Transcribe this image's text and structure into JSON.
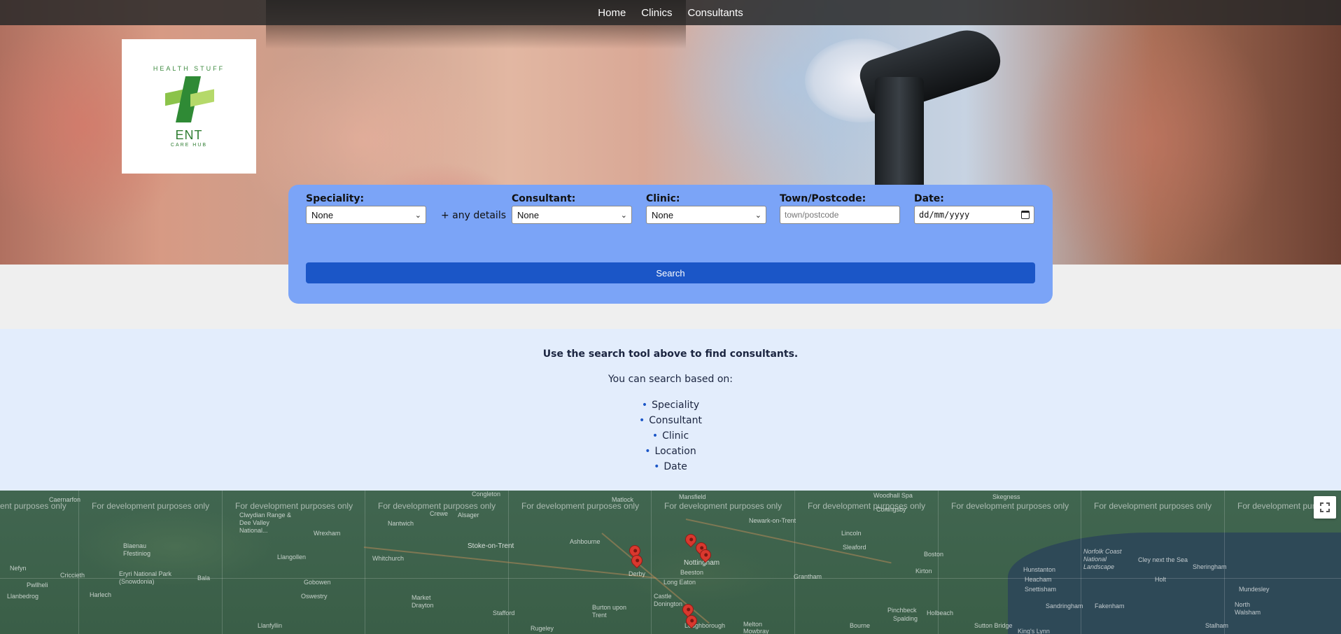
{
  "nav": {
    "items": [
      {
        "label": "Home"
      },
      {
        "label": "Clinics"
      },
      {
        "label": "Consultants"
      }
    ]
  },
  "logo": {
    "arc_text": "HEALTH STUFF",
    "name": "ENT",
    "tagline": "CARE HUB",
    "colors": {
      "primary": "#2f8a35",
      "secondary": "#8bc34a"
    }
  },
  "search": {
    "speciality": {
      "label": "Speciality:",
      "value": "None"
    },
    "any_details": "+ any details",
    "consultant": {
      "label": "Consultant:",
      "value": "None"
    },
    "clinic": {
      "label": "Clinic:",
      "value": "None"
    },
    "town": {
      "label": "Town/Postcode:",
      "placeholder": "town/postcode"
    },
    "date": {
      "label": "Date:",
      "value": "dd/mm/yyyy"
    },
    "button_label": "Search",
    "panel_color": "#7ba4f7",
    "button_color": "#1b56c7"
  },
  "info": {
    "title": "Use the search tool above to find consultants.",
    "subtitle": "You can search based on:",
    "items": [
      "Speciality",
      "Consultant",
      "Clinic",
      "Location",
      "Date"
    ]
  },
  "map": {
    "watermark": "For development purposes only",
    "watermark_start": "ent purposes only",
    "watermark_end": "For development pur",
    "places": {
      "caernarfon": "Caernarfon",
      "congleton": "Congleton",
      "matlock": "Matlock",
      "mansfield": "Mansfield",
      "woodhall_spa": "Woodhall Spa",
      "skegness": "Skegness",
      "coningsby": "Coningsby",
      "clwydian": "Clwydian Range & Dee Valley National...",
      "nantwich": "Nantwich",
      "crewe": "Crewe",
      "alsager": "Alsager",
      "newark": "Newark-on-Trent",
      "blaenau": "Blaenau Ffestiniog",
      "wrexham": "Wrexham",
      "stoke": "Stoke-on-Trent",
      "ashbourne": "Ashbourne",
      "lincoln": "Lincoln",
      "sleaford": "Sleaford",
      "boston": "Boston",
      "llangollen": "Llangollen",
      "whitchurch": "Whitchurch",
      "derby": "Derby",
      "nottingham": "Nottingham",
      "beeston": "Beeston",
      "norfolk": "Norfolk Coast National Landscape",
      "cley": "Cley next the Sea",
      "sheringham": "Sheringham",
      "holt": "Holt",
      "hunstanton": "Hunstanton",
      "heacham": "Heacham",
      "snettisham": "Snettisham",
      "kirton": "Kirton",
      "grantham": "Grantham",
      "long_eaton": "Long Eaton",
      "nefyn": "Nefyn",
      "eryri": "Eryri National Park (Snowdonia)",
      "bala": "Bala",
      "gobowen": "Gobowen",
      "pwllheli": "Pwllheli",
      "criccieth": "Criccieth",
      "harlech": "Harlech",
      "llanbedrog": "Llanbedrog",
      "oswestry": "Oswestry",
      "market_drayton": "Market Drayton",
      "castle_donington": "Castle Donington",
      "sandringham": "Sandringham",
      "fakenham": "Fakenham",
      "mundesley": "Mundesley",
      "north_walsham": "North Walsham",
      "pinchbeck": "Pinchbeck",
      "spalding": "Spalding",
      "holbeach": "Holbeach",
      "stafford": "Stafford",
      "burton": "Burton upon Trent",
      "loughborough": "Loughborough",
      "melton": "Melton Mowbray",
      "bourne": "Bourne",
      "llanfyllin": "Llanfyllin",
      "rugeley": "Rugeley",
      "sutton_bridge": "Sutton Bridge",
      "kings_lynn": "King's Lynn",
      "stalham": "Stalham"
    }
  }
}
